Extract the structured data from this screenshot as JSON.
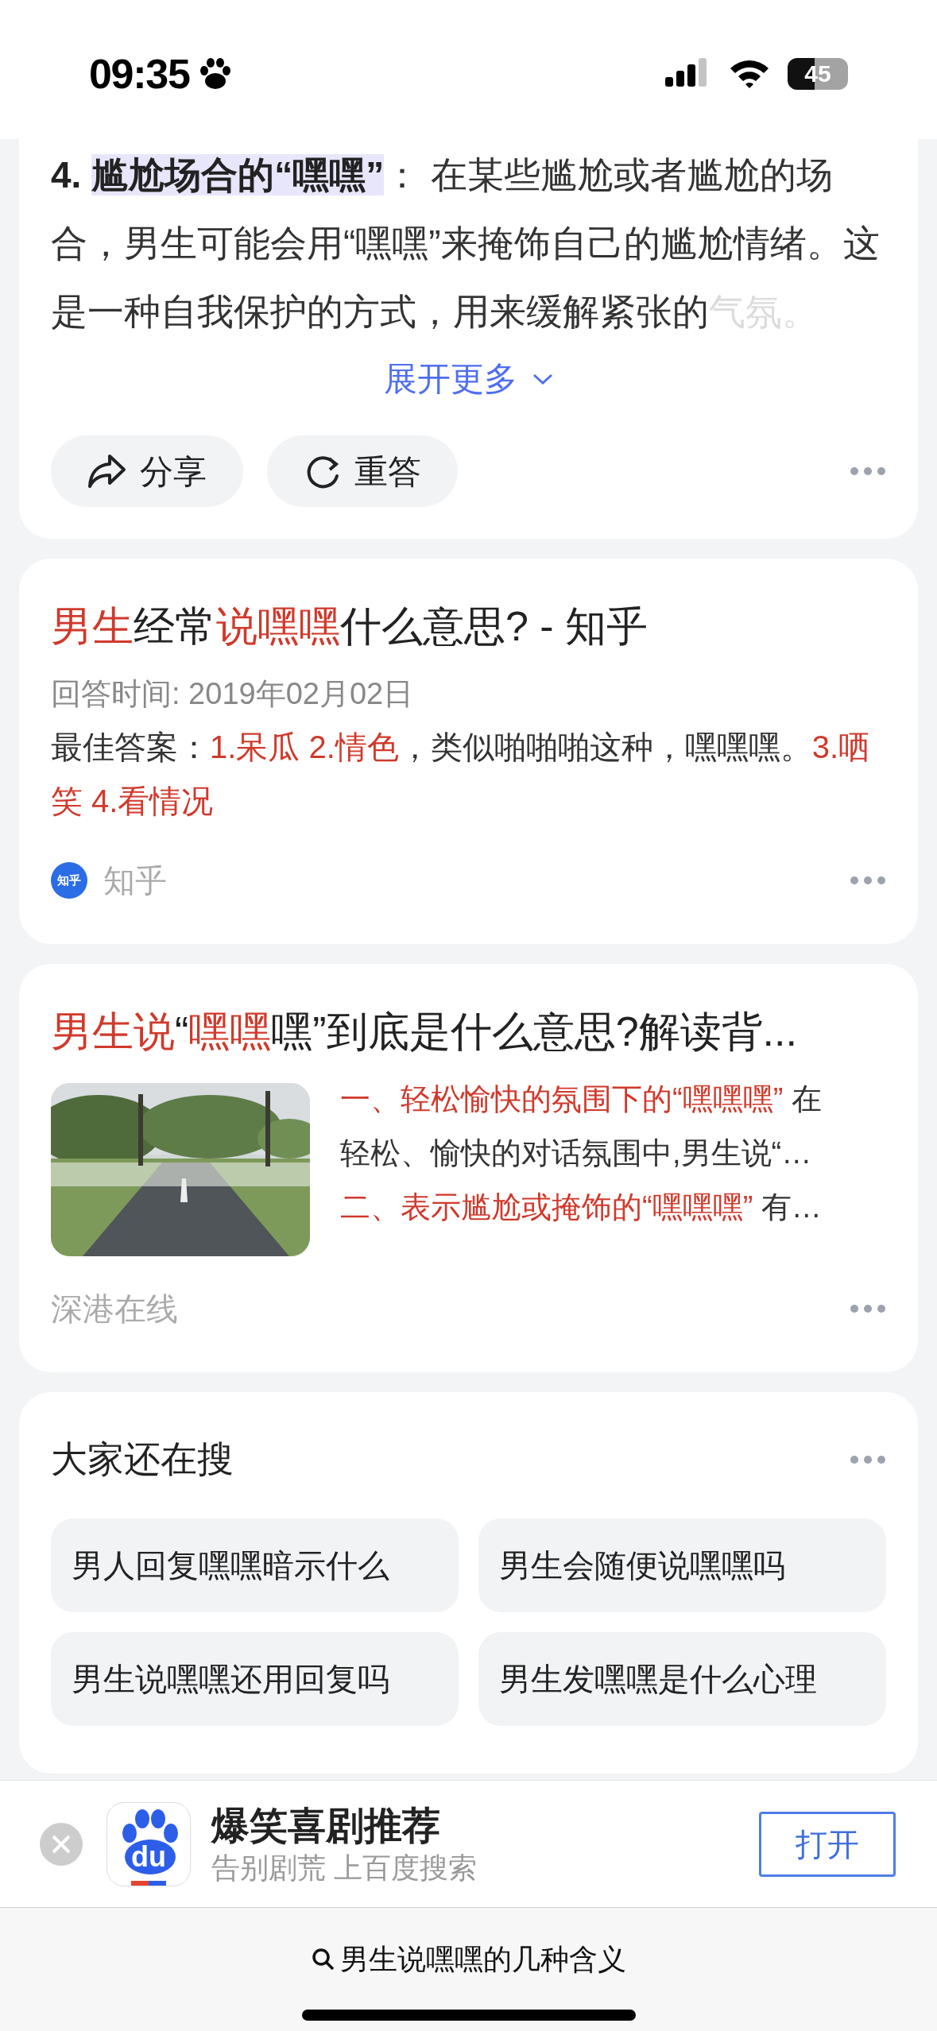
{
  "status_bar": {
    "time": "09:35",
    "battery": "45"
  },
  "answer_card": {
    "paragraph": [
      {
        "text": "4. ",
        "bold": true,
        "highlight": false,
        "faded": false
      },
      {
        "text": "尴尬场合的“嘿嘿”",
        "bold": true,
        "highlight": true,
        "faded": false
      },
      {
        "text": "： 在某些尴尬或者尴尬的场合，男生可能会用“嘿嘿”来掩饰自己的尴尬情绪。这是一种自我保护的方式，用来缓解紧张的",
        "bold": false,
        "highlight": false,
        "faded": false
      },
      {
        "text": "气氛。",
        "bold": false,
        "highlight": false,
        "faded": true
      }
    ],
    "expand": "展开更多",
    "actions": [
      {
        "kind": "share",
        "label": "分享"
      },
      {
        "kind": "retry",
        "label": "重答"
      }
    ]
  },
  "results": [
    {
      "kind": "text",
      "title": [
        {
          "text": "男生",
          "red": true
        },
        {
          "text": "经常",
          "red": false
        },
        {
          "text": "说嘿嘿",
          "red": true
        },
        {
          "text": "什么意思? - 知乎",
          "red": false
        }
      ],
      "meta": "回答时间: 2019年02月02日",
      "snippet": [
        {
          "text": "最佳答案：",
          "red": false
        },
        {
          "text": "1.呆瓜 2.情色",
          "red": true
        },
        {
          "text": "，类似啪啪啪这种，嘿嘿嘿。",
          "red": false
        },
        {
          "text": "3.哂笑 4.看情况",
          "red": true
        }
      ],
      "source": {
        "name": "知乎",
        "logo_text": "知乎"
      }
    },
    {
      "title": [
        {
          "text": "男生说",
          "red": true
        },
        {
          "text": "“",
          "red": false
        },
        {
          "text": "嘿嘿",
          "red": true
        },
        {
          "text": "嘿”到底是什么意思?解读背...",
          "red": false
        }
      ],
      "snippet_lines": [
        [
          {
            "text": "一、轻松愉快的氛围下的“嘿嘿嘿”",
            "red": true
          },
          {
            "text": " 在",
            "red": false
          }
        ],
        [
          {
            "text": "轻松、愉快的对话氛围中,男生说“…",
            "red": false
          }
        ],
        [
          {
            "text": "二、表示尴尬或掩饰的“嘿嘿嘿”",
            "red": true
          },
          {
            "text": " 有…",
            "red": false
          }
        ]
      ],
      "source": {
        "name": "深港在线"
      }
    }
  ],
  "related": {
    "title": "大家还在搜",
    "items": [
      "男人回复嘿嘿暗示什么",
      "男生会随便说嘿嘿吗",
      "男生说嘿嘿还用回复吗",
      "男生发嘿嘿是什么心理"
    ]
  },
  "app_banner": {
    "logo_text": "du",
    "title": "爆笑喜剧推荐",
    "subtitle": "告别剧荒 上百度搜索",
    "button": "打开"
  },
  "bottom_bar": {
    "query": "男生说嘿嘿的几种含义"
  }
}
